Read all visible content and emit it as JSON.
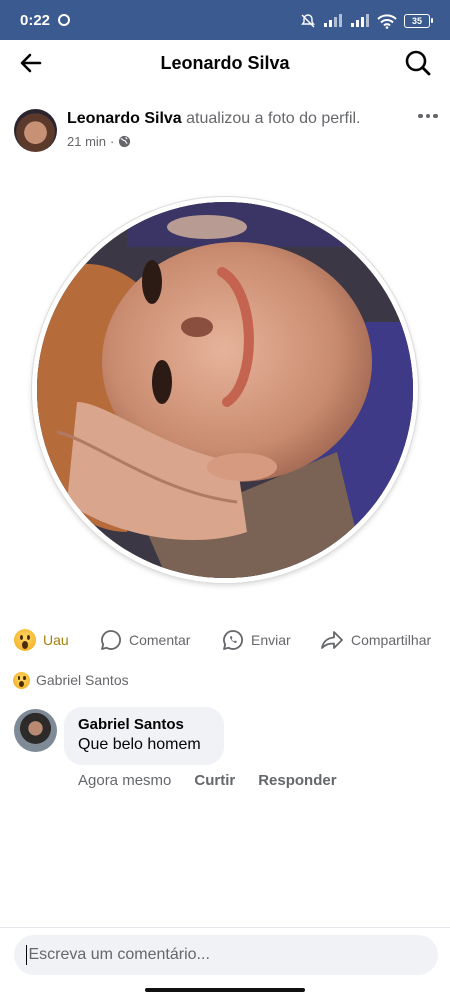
{
  "status_bar": {
    "time": "0:22",
    "battery": "35"
  },
  "header": {
    "title": "Leonardo Silva",
    "back_icon": "arrow-left-icon",
    "search_icon": "search-icon"
  },
  "post": {
    "author": "Leonardo Silva",
    "action": "atualizou a foto do perfil.",
    "time": "21 min",
    "separator": "·",
    "audience_icon": "globe-icon",
    "more_icon": "more-horizontal-icon"
  },
  "actions": {
    "reaction": "Uau",
    "comment": "Comentar",
    "send": "Enviar",
    "share": "Compartilhar"
  },
  "reactions_summary": {
    "names": "Gabriel Santos"
  },
  "comments": [
    {
      "author": "Gabriel Santos",
      "text": "Que belo homem",
      "time": "Agora mesmo",
      "like": "Curtir",
      "reply": "Responder"
    }
  ],
  "composer": {
    "placeholder": "Escreva um comentário..."
  },
  "colors": {
    "status_bar": "#3b5a8f",
    "reaction_active": "#a27f0e",
    "secondary_text": "#65676b",
    "bubble_bg": "#f0f2f5"
  }
}
